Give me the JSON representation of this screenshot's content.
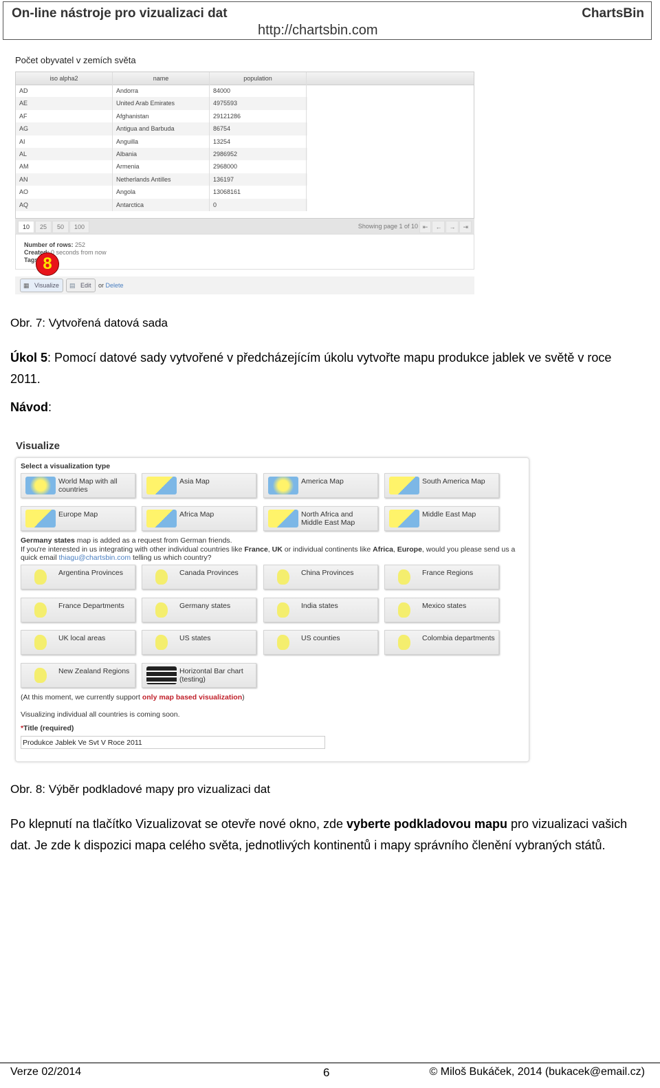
{
  "header": {
    "title": "On-line nástroje pro vizualizaci dat",
    "brand": "ChartsBin",
    "url": "http://chartsbin.com"
  },
  "dataset": {
    "title": "Počet obyvatel v zemích světa",
    "columns": [
      "iso alpha2",
      "name",
      "population"
    ],
    "rows": [
      [
        "AD",
        "Andorra",
        "84000"
      ],
      [
        "AE",
        "United Arab Emirates",
        "4975593"
      ],
      [
        "AF",
        "Afghanistan",
        "29121286"
      ],
      [
        "AG",
        "Antigua and Barbuda",
        "86754"
      ],
      [
        "AI",
        "Anguilla",
        "13254"
      ],
      [
        "AL",
        "Albania",
        "2986952"
      ],
      [
        "AM",
        "Armenia",
        "2968000"
      ],
      [
        "AN",
        "Netherlands Antilles",
        "136197"
      ],
      [
        "AO",
        "Angola",
        "13068161"
      ],
      [
        "AQ",
        "Antarctica",
        "0"
      ]
    ],
    "page_sizes": [
      "10",
      "25",
      "50",
      "100"
    ],
    "paging": "Showing page 1 of 10",
    "rows_label": "Number of rows:",
    "rows_value": "252",
    "created_label": "Created:",
    "created_value": "0 seconds from now",
    "tags_label": "Tags",
    "visualize": "Visualize",
    "edit": "Edit",
    "or": "or",
    "delete": "Delete",
    "badge": "8"
  },
  "caption1": "Obr. 7: Vytvořená datová sada",
  "task": {
    "label": "Úkol 5",
    "text": ": Pomocí datové sady vytvořené v předcházejícím úkolu vytvořte mapu produkce jablek ve světě v roce 2011."
  },
  "guide": {
    "label": "Návod",
    "colon": ":"
  },
  "viz": {
    "title": "Visualize",
    "select": "Select a visualization type",
    "maps1": [
      {
        "label": "World Map with all countries",
        "icon": "world-map-icon"
      },
      {
        "label": "Asia Map",
        "icon": "asia-map-icon"
      },
      {
        "label": "America Map",
        "icon": "america-map-icon"
      },
      {
        "label": "South America Map",
        "icon": "south-america-map-icon"
      },
      {
        "label": "Europe Map",
        "icon": "europe-map-icon"
      },
      {
        "label": "Africa Map",
        "icon": "africa-map-icon"
      },
      {
        "label": "North Africa and Middle East Map",
        "icon": "north-africa-map-icon"
      },
      {
        "label": "Middle East Map",
        "icon": "middle-east-map-icon"
      }
    ],
    "note1_bold": "Germany states",
    "note1": " map is added as a request from German friends.",
    "note2a": "If you're interested in us integrating with other individual countries like ",
    "note2b": "France",
    "note2c": ", ",
    "note2d": "UK",
    "note2e": " or individual continents like ",
    "note2f": "Africa",
    "note2g": ", ",
    "note2h": "Europe",
    "note2i": ", would you please send us a quick email ",
    "email": "thiagu@chartsbin.com",
    "note2j": " telling us which country?",
    "maps2": [
      {
        "label": "Argentina Provinces"
      },
      {
        "label": "Canada Provinces"
      },
      {
        "label": "China Provinces"
      },
      {
        "label": "France Regions"
      },
      {
        "label": "France Departments"
      },
      {
        "label": "Germany states"
      },
      {
        "label": "India states"
      },
      {
        "label": "Mexico states"
      },
      {
        "label": "UK local areas"
      },
      {
        "label": "US states"
      },
      {
        "label": "US counties"
      },
      {
        "label": "Colombia departments"
      },
      {
        "label": "New Zealand Regions"
      },
      {
        "label": "Horizontal Bar chart (testing)"
      }
    ],
    "support_a": "(At this moment, we currently support ",
    "support_b": "only map based visualization",
    "support_c": ")",
    "soon": "Visualizing individual all countries is coming soon.",
    "title_star": "*",
    "title_label": "Title (required)",
    "title_value": "Produkce Jablek Ve Svt V Roce 2011"
  },
  "caption2": "Obr. 8: Výběr podkladové mapy pro vizualizaci dat",
  "para": {
    "a": "Po klepnutí na tlačítko Vizualizovat se otevře nové okno, zde ",
    "b": "vyberte podkladovou mapu",
    "c": " pro vizualizaci vašich dat. Je zde k dispozici mapa celého světa, jednotlivých kontinentů i mapy správního členění vybraných států."
  },
  "footer": {
    "version": "Verze 02/2014",
    "page": "6",
    "copyright": "© Miloš Bukáček, 2014 (bukacek@email.cz)"
  }
}
